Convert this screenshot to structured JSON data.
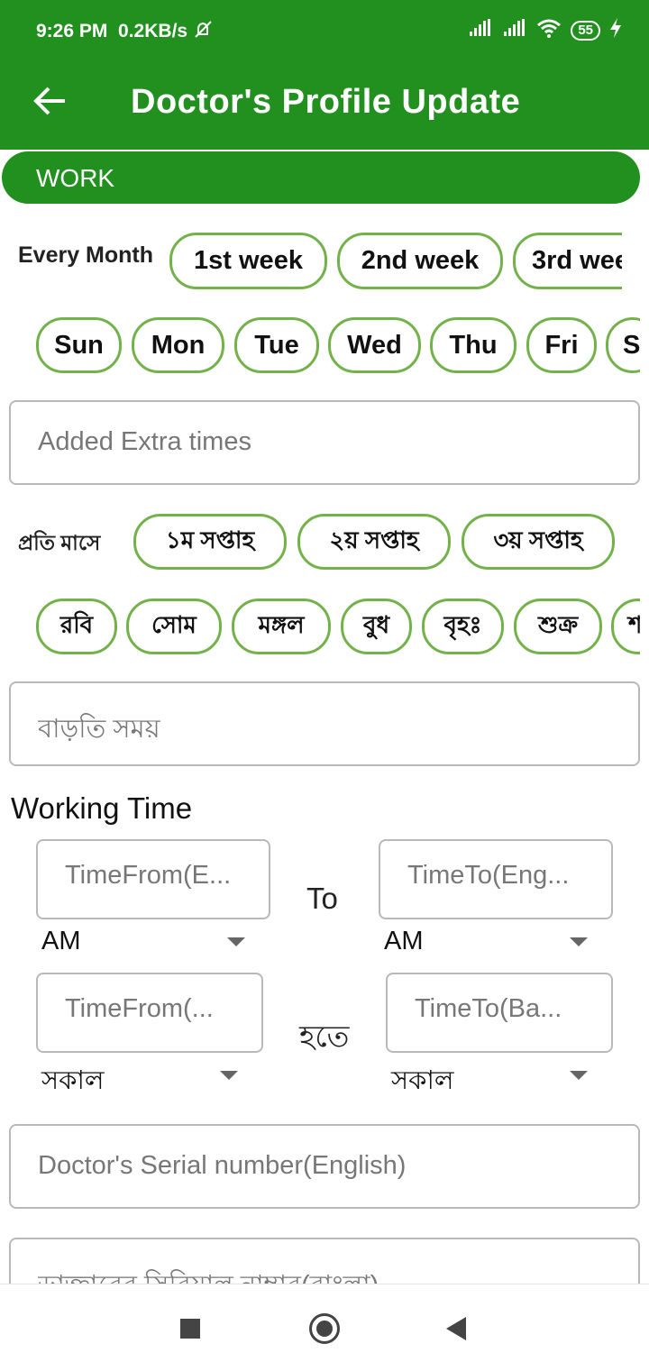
{
  "status": {
    "time": "9:26 PM",
    "speed": "0.2KB/s",
    "battery": "55"
  },
  "appbar": {
    "title": "Doctor's Profile Update"
  },
  "tab": {
    "label": "WORK"
  },
  "english": {
    "every_month_label": "Every Month",
    "weeks": [
      "1st week",
      "2nd week",
      "3rd wee"
    ],
    "days": [
      "Sun",
      "Mon",
      "Tue",
      "Wed",
      "Thu",
      "Fri",
      "S"
    ],
    "extra_times_placeholder": "Added Extra times"
  },
  "bangla": {
    "every_month_label": "প্রতি মাসে",
    "weeks": [
      "১ম সপ্তাহ",
      "২য় সপ্তাহ",
      "৩য় সপ্তাহ"
    ],
    "days": [
      "রবি",
      "সোম",
      "মঙ্গল",
      "বুধ",
      "বৃহঃ",
      "শুক্র",
      "শ"
    ],
    "extra_times_placeholder": "বাড়তি সময়"
  },
  "working_time": {
    "title": "Working Time",
    "en": {
      "from_placeholder": "TimeFrom(E...",
      "to_label": "To",
      "to_placeholder": "TimeTo(Eng...",
      "from_ampm": "AM",
      "to_ampm": "AM"
    },
    "bn": {
      "from_placeholder": "TimeFrom(...",
      "to_label": "হতে",
      "to_placeholder": "TimeTo(Ba...",
      "from_ampm": "সকাল",
      "to_ampm": "সকাল"
    }
  },
  "serial": {
    "english_placeholder": "Doctor's Serial number(English)",
    "bangla_placeholder": "ডাক্তারের সিরিয়াল নাম্বার(বাংলা)"
  },
  "colors": {
    "primary": "#22901f",
    "chip_border": "#73b24a"
  }
}
